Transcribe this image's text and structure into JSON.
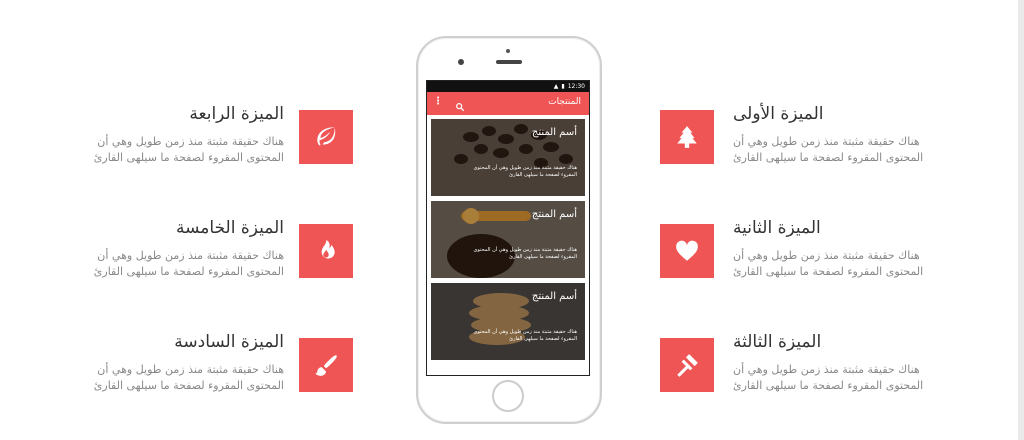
{
  "features": {
    "f1": {
      "title": "الميزة الأولى",
      "desc1": "هناك حقيقة مثبتة منذ زمن طويل وهي أن",
      "desc2": "المحتوى المقروء لصفحة ما سيلهى القارئ",
      "icon": "tree-icon"
    },
    "f2": {
      "title": "الميزة الثانية",
      "desc1": "هناك حقيقة مثبتة منذ زمن طويل وهي أن",
      "desc2": "المحتوى المقروء لصفحة ما سيلهى القارئ",
      "icon": "heart-icon"
    },
    "f3": {
      "title": "الميزة الثالثة",
      "desc1": "هناك حقيقة مثبتة منذ زمن طويل وهي أن",
      "desc2": "المحتوى المقروء لصفحة ما سيلهى القارئ",
      "icon": "gavel-icon"
    },
    "f4": {
      "title": "الميزة الرابعة",
      "desc1": "هناك حقيقة مثبتة منذ زمن طويل وهي أن",
      "desc2": "المحتوى المقروء لصفحة ما سيلهى القارئ",
      "icon": "leaf-icon"
    },
    "f5": {
      "title": "الميزة الخامسة",
      "desc1": "هناك حقيقة مثبتة منذ زمن طويل وهي أن",
      "desc2": "المحتوى المقروء لصفحة ما سيلهى القارئ",
      "icon": "flame-icon"
    },
    "f6": {
      "title": "الميزة السادسة",
      "desc1": "هناك حقيقة مثبتة منذ زمن طويل وهي أن",
      "desc2": "المحتوى المقروء لصفحة ما سيلهى القارئ",
      "icon": "brush-icon"
    }
  },
  "phone": {
    "time": "12:30",
    "appbar_title": "المنتجات",
    "menu_glyph": "⋮",
    "products": [
      {
        "name": "أسم المنتج",
        "desc1": "هناك حقيقة مثبتة منذ زمن طويل وهي أن المحتوى",
        "desc2": "المقروء لصفحة ما سيلهى القارئ",
        "image": "coffee-beans"
      },
      {
        "name": "أسم المنتج",
        "desc1": "هناك حقيقة مثبتة منذ زمن طويل وهي أن المحتوى",
        "desc2": "المقروء لصفحة ما سيلهى القارئ",
        "image": "honey"
      },
      {
        "name": "أسم المنتج",
        "desc1": "هناك حقيقة مثبتة منذ زمن طويل وهي أن المحتوى",
        "desc2": "المقروء لصفحة ما سيلهى القارئ",
        "image": "cookies"
      }
    ]
  },
  "colors": {
    "accent": "#f05555",
    "title": "#333333",
    "text": "#888888"
  }
}
